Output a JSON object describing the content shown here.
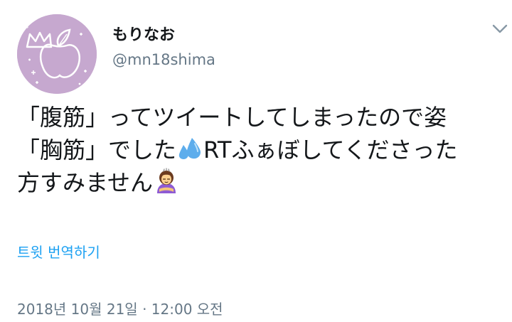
{
  "user": {
    "display_name": "もりなお",
    "handle": "@mn18shima",
    "avatar_icon": "crown-apple-avatar",
    "avatar_color": "#c6a8cf"
  },
  "menu": {
    "icon": "chevron-down-icon"
  },
  "tweet": {
    "line1": "「腹筋」ってツイートしてしまったので姿",
    "line2_a": "「胸筋」でした",
    "line2_b": "RTふぁぼしてくださった",
    "line3": "方すみません",
    "emoji_1": "sweat-droplets-icon",
    "emoji_2": "person-bowing-icon"
  },
  "translate": {
    "label": "트윗 번역하기"
  },
  "meta": {
    "timestamp": "2018년 10월 21일 · 12:00 오전"
  },
  "colors": {
    "link": "#1da1f2",
    "secondary_text": "#657786",
    "primary_text": "#14171a"
  }
}
